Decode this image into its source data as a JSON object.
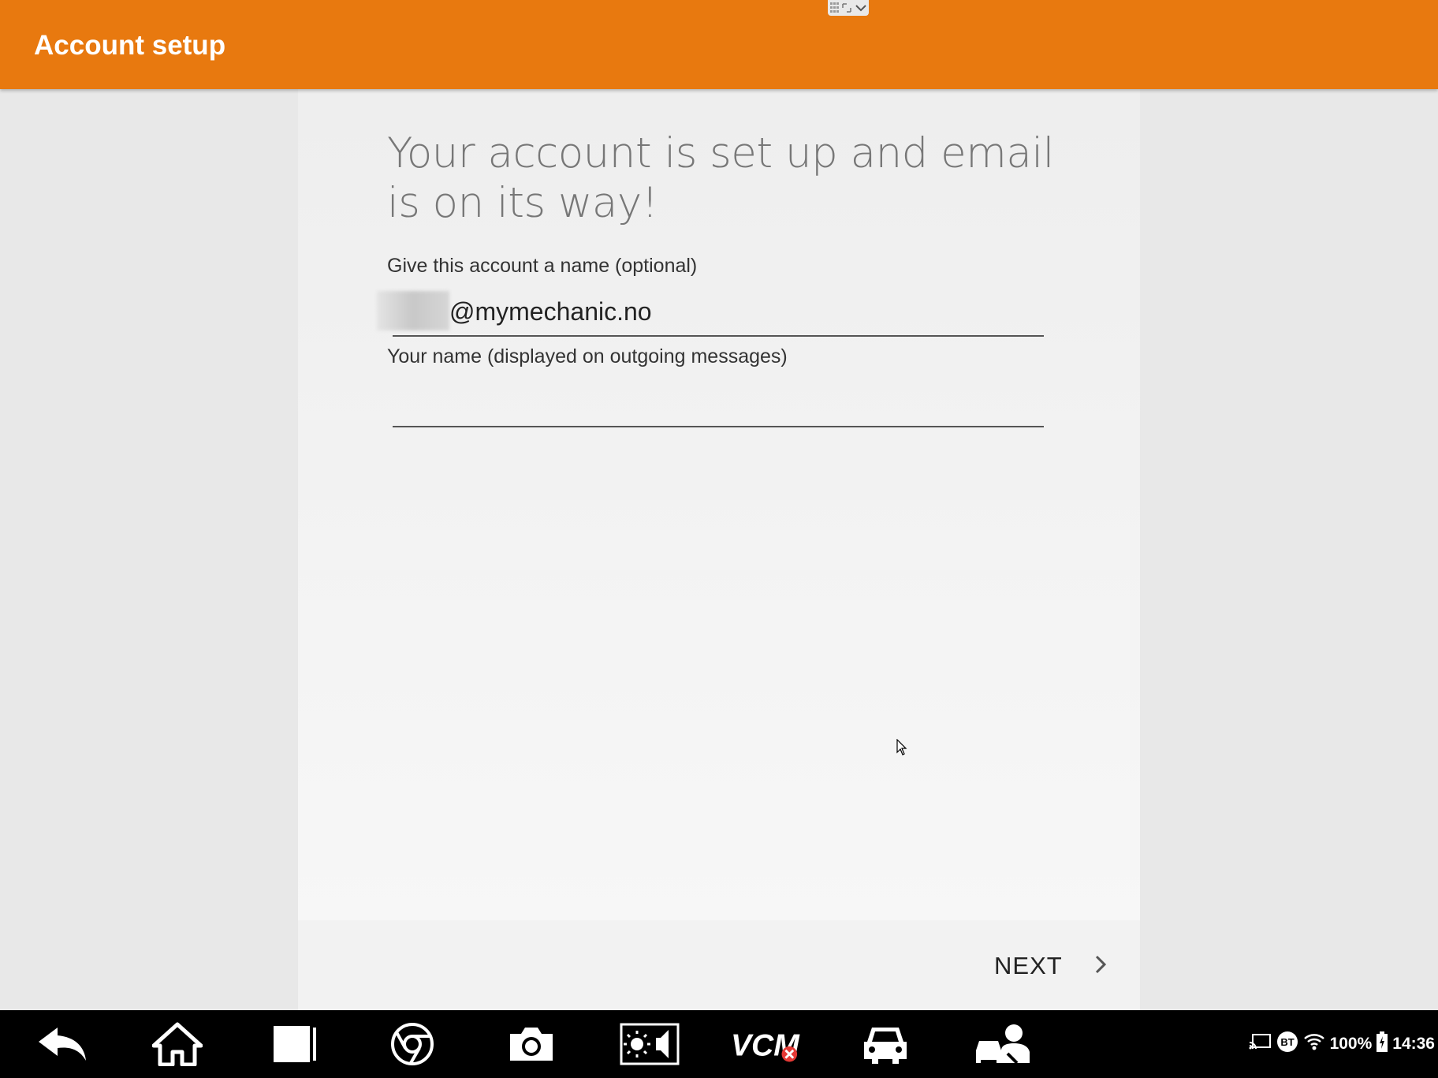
{
  "appbar": {
    "title": "Account setup"
  },
  "content": {
    "heading": "Your account is set up and email is on its way!",
    "account_name_label": "Give this account a name (optional)",
    "account_name_value": "@mymechanic.no",
    "your_name_label": "Your name (displayed on outgoing messages)",
    "your_name_value": ""
  },
  "footer": {
    "next_label": "NEXT"
  },
  "colors": {
    "accent": "#e8790f",
    "navbar": "#000000",
    "vcm_error": "#e53935"
  },
  "navbar": {
    "icons": [
      "back-icon",
      "home-icon",
      "recent-apps-icon",
      "chrome-icon",
      "camera-icon",
      "brightness-volume-icon",
      "vcm-icon",
      "car-icon",
      "mechanic-icon"
    ],
    "vcm_text": "VCM"
  },
  "status": {
    "battery": "100%",
    "time": "14:36",
    "bt": "BT"
  }
}
